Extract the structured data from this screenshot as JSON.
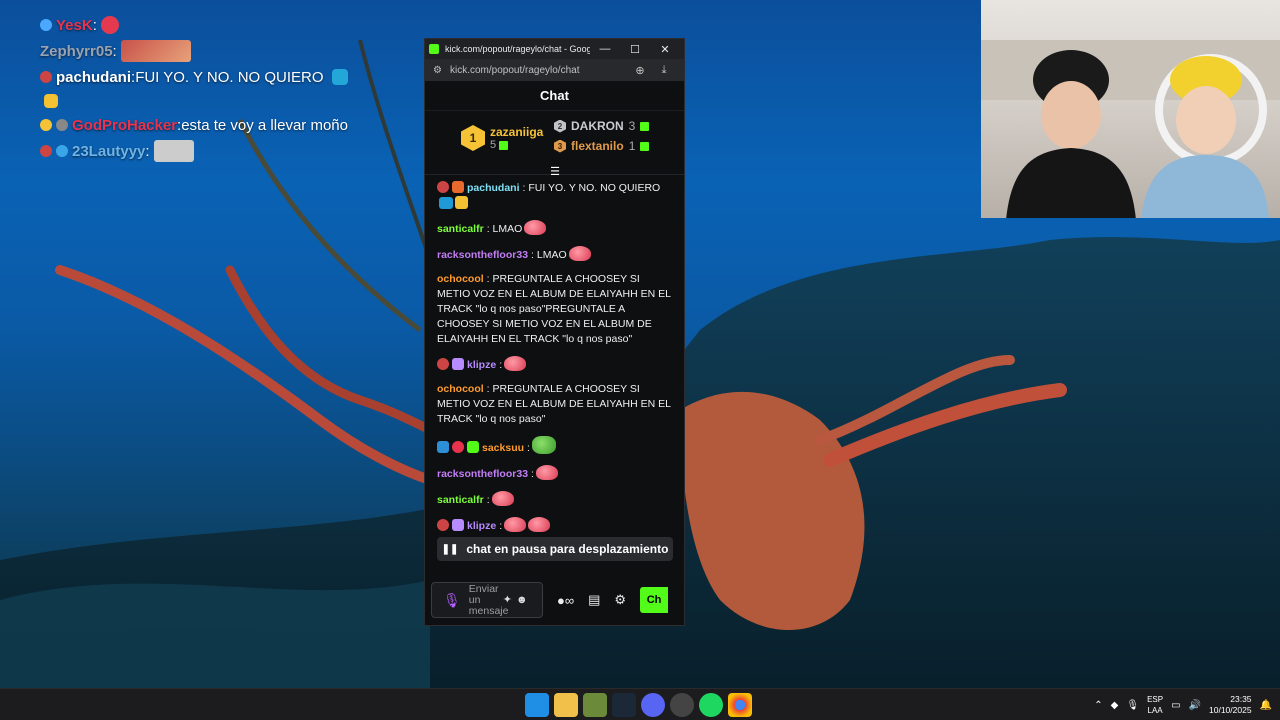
{
  "overlay_chat": [
    {
      "user": "YesK",
      "color": "#e8334e",
      "suffix": ":",
      "text": ""
    },
    {
      "user": "Zephyrr05",
      "color": "#9aa3b0",
      "suffix": ":",
      "text": ""
    },
    {
      "user": "pachudani",
      "color": "#ffffff",
      "suffix": ":",
      "text": " FUI YO. Y NO. NO QUIERO"
    },
    {
      "user": "GodProHacker",
      "color": "#e8334e",
      "suffix": ":",
      "text": " esta te voy a llevar moño"
    },
    {
      "user": "23Lautyyy",
      "color": "#6fb4e6",
      "suffix": ":",
      "text": ""
    }
  ],
  "window": {
    "title": "kick.com/popout/rageylo/chat - Google...",
    "url": "kick.com/popout/rageylo/chat",
    "minimize": "—",
    "maximize": "☐",
    "close": "✕",
    "zoom_icon": "⊕",
    "download_icon": "⤓"
  },
  "chat": {
    "header": "Chat",
    "leaderboard": {
      "first": {
        "rank": "1",
        "name": "zazaniiga",
        "count": "5"
      },
      "second": {
        "rank": "2",
        "name": "DAKRON",
        "count": "3"
      },
      "third": {
        "rank": "3",
        "name": "flextanilo",
        "count": "1"
      }
    },
    "messages": [
      {
        "user": "pachudani",
        "color": "#7ee0f5",
        "text": "FUI YO. Y NO. NO QUIERO"
      },
      {
        "user": "santicalfr",
        "color": "#7dff3c",
        "text": "LMAO"
      },
      {
        "user": "racksonthefloor33",
        "color": "#c17ef5",
        "text": "LMAO"
      },
      {
        "user": "ochocool",
        "color": "#ff9c2f",
        "text": "PREGUNTALE A CHOOSEY SI METIO VOZ EN EL ALBUM DE ELAIYAHH EN EL TRACK \"lo q nos paso\"PREGUNTALE A CHOOSEY SI METIO VOZ EN EL ALBUM DE ELAIYAHH EN EL TRACK \"lo q nos paso\""
      },
      {
        "user": "klipze",
        "color": "#b78cff",
        "text": ""
      },
      {
        "user": "ochocool",
        "color": "#ff9c2f",
        "text": "PREGUNTALE A CHOOSEY SI METIO VOZ EN EL ALBUM DE ELAIYAHH EN EL TRACK \"lo q nos paso\""
      },
      {
        "user": "sacksuu",
        "color": "#ff9c2f",
        "text": ""
      },
      {
        "user": "racksonthefloor33",
        "color": "#c17ef5",
        "text": ""
      },
      {
        "user": "santicalfr",
        "color": "#7dff3c",
        "text": ""
      },
      {
        "user": "klipze",
        "color": "#b78cff",
        "text": ""
      }
    ],
    "pause_label": "chat en pausa para desplazamiento",
    "input_placeholder": "Enviar un mensaje",
    "send_label": "Ch"
  },
  "taskbar": {
    "lang_top": "ESP",
    "lang_bottom": "LAA",
    "time": "23:35",
    "date": "10/10/2025"
  }
}
